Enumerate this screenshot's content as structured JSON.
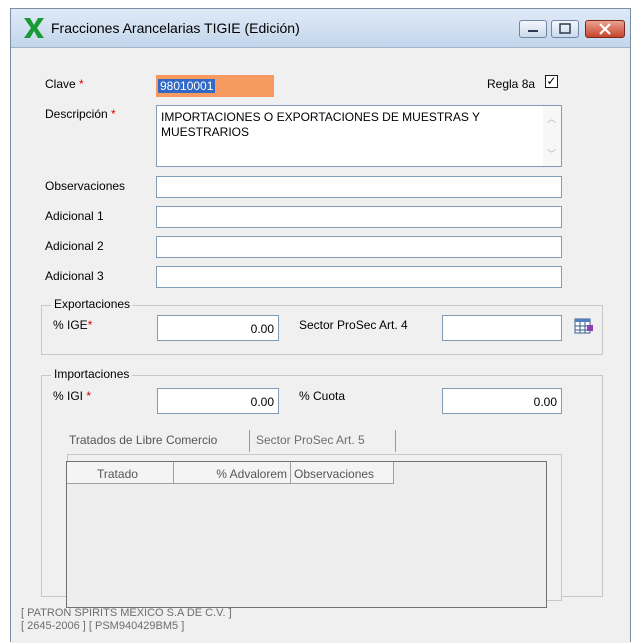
{
  "window": {
    "title": "Fracciones Arancelarias TIGIE (Edición)",
    "accent": "#1a9a35"
  },
  "form": {
    "clave_label": "Clave",
    "clave_value": "98010001",
    "required_marker": "*",
    "regla_label": "Regla 8a",
    "regla_checked": "✓",
    "descripcion_label": "Descripción",
    "descripcion_value": "IMPORTACIONES O EXPORTACIONES DE MUESTRAS Y MUESTRARIOS",
    "observaciones_label": "Observaciones",
    "adicional1_label": "Adicional 1",
    "adicional2_label": "Adicional 2",
    "adicional3_label": "Adicional 3"
  },
  "exportaciones": {
    "group_label": "Exportaciones",
    "ige_label": "% IGE",
    "ige_value": "0.00",
    "sector_label": "Sector ProSec Art. 4"
  },
  "importaciones": {
    "group_label": "Importaciones",
    "igi_label": "% IGI",
    "igi_value": "0.00",
    "cuota_label": "% Cuota",
    "cuota_value": "0.00"
  },
  "tabs": [
    {
      "label": "Tratados de Libre Comercio"
    },
    {
      "label": "Sector ProSec Art. 5"
    }
  ],
  "grid": {
    "columns": [
      "Tratado",
      "% Advalorem",
      "Observaciones"
    ]
  },
  "footer": {
    "line1": "[ PATRON SPIRITS MEXICO S.A DE C.V. ]",
    "line2": "[ 2645-2006 ]  [ PSM940429BM5 ]"
  }
}
